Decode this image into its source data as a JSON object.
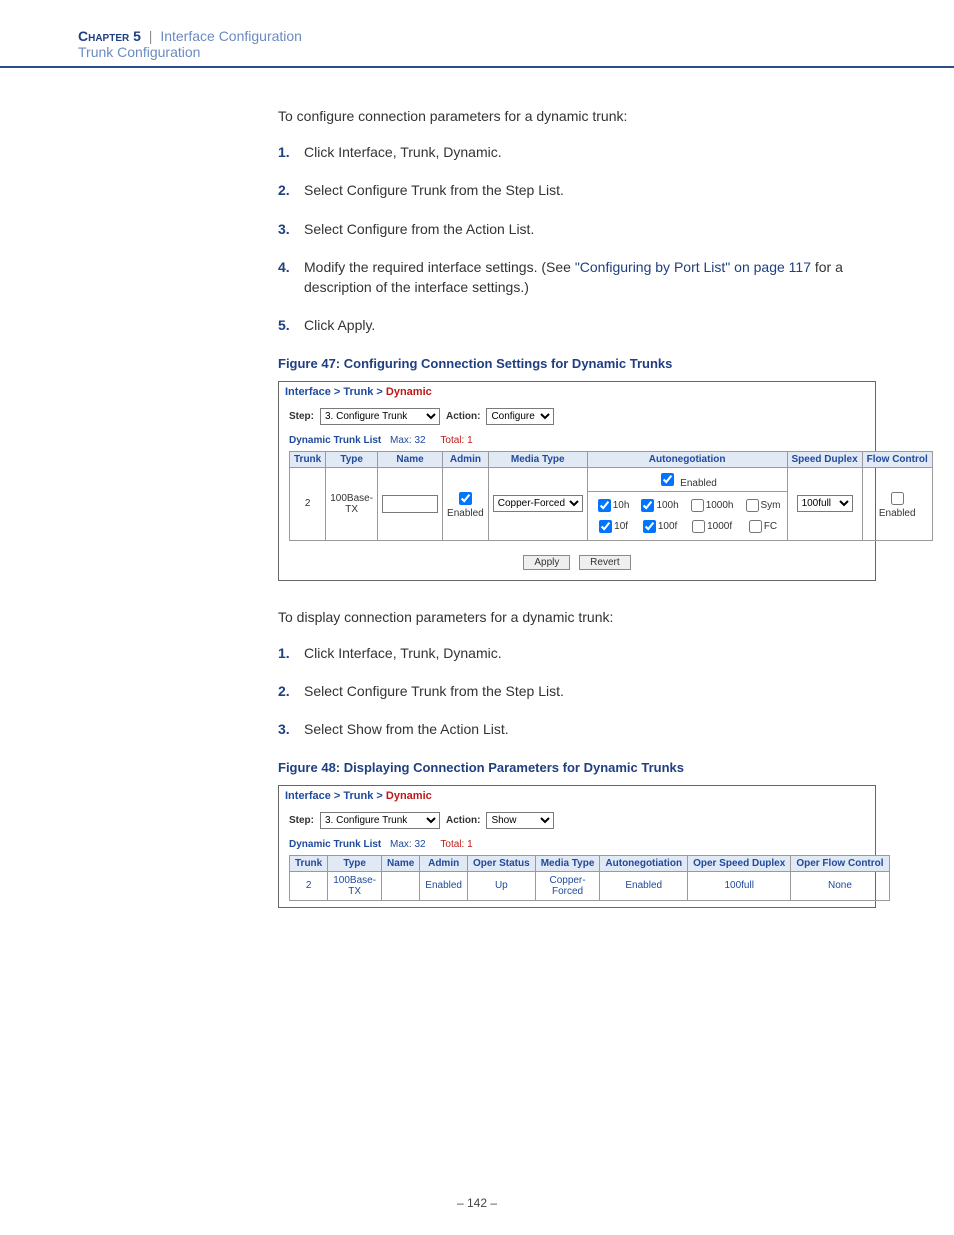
{
  "header": {
    "chapter": "Chapter 5",
    "separator": "|",
    "chapter_title": "Interface Configuration",
    "section": "Trunk Configuration"
  },
  "section1": {
    "intro": "To configure connection parameters for a dynamic trunk:",
    "steps": [
      "Click Interface, Trunk, Dynamic.",
      "Select Configure Trunk from the Step List.",
      "Select Configure from the Action List.",
      "Modify the required interface settings. (See ",
      "Click Apply."
    ],
    "step4_link": "\"Configuring by Port List\" on page 117",
    "step4_tail": " for a description of the interface settings.)",
    "figure_caption": "Figure 47:  Configuring Connection Settings for Dynamic Trunks"
  },
  "shot1": {
    "breadcrumb": {
      "a": "Interface",
      "b": "Trunk",
      "c": "Dynamic"
    },
    "step_label": "Step:",
    "step_value": "3. Configure Trunk",
    "action_label": "Action:",
    "action_value": "Configure",
    "list_title": "Dynamic Trunk List",
    "max_label": "Max: 32",
    "total_label": "Total: 1",
    "headers": [
      "Trunk",
      "Type",
      "Name",
      "Admin",
      "Media Type",
      "Autonegotiation",
      "Speed Duplex",
      "Flow Control"
    ],
    "row": {
      "trunk": "2",
      "type": "100Base-TX",
      "name": "",
      "admin_checked": true,
      "admin_text": "Enabled",
      "media_value": "Copper-Forced",
      "autoneg_enabled_label": "Enabled",
      "autoneg_enabled": true,
      "caps": {
        "h10": {
          "label": "10h",
          "checked": true
        },
        "h100": {
          "label": "100h",
          "checked": true
        },
        "h1000": {
          "label": "1000h",
          "checked": false
        },
        "sym": {
          "label": "Sym",
          "checked": false
        },
        "f10": {
          "label": "10f",
          "checked": true
        },
        "f100": {
          "label": "100f",
          "checked": true
        },
        "f1000": {
          "label": "1000f",
          "checked": false
        },
        "fc": {
          "label": "FC",
          "checked": false
        }
      },
      "speed_duplex": "100full",
      "flow_label": "Enabled",
      "flow_checked": false
    },
    "buttons": {
      "apply": "Apply",
      "revert": "Revert"
    }
  },
  "section2": {
    "intro": "To display connection parameters for a dynamic trunk:",
    "steps": [
      "Click Interface, Trunk, Dynamic.",
      "Select Configure Trunk from the Step List.",
      "Select Show from the Action List."
    ],
    "figure_caption": "Figure 48:  Displaying Connection Parameters for Dynamic Trunks"
  },
  "shot2": {
    "breadcrumb": {
      "a": "Interface",
      "b": "Trunk",
      "c": "Dynamic"
    },
    "step_label": "Step:",
    "step_value": "3. Configure Trunk",
    "action_label": "Action:",
    "action_value": "Show",
    "list_title": "Dynamic Trunk List",
    "max_label": "Max: 32",
    "total_label": "Total: 1",
    "headers": [
      "Trunk",
      "Type",
      "Name",
      "Admin",
      "Oper Status",
      "Media Type",
      "Autonegotiation",
      "Oper Speed Duplex",
      "Oper Flow Control"
    ],
    "row": {
      "trunk": "2",
      "type": "100Base-TX",
      "name": "",
      "admin": "Enabled",
      "oper_status": "Up",
      "media": "Copper-Forced",
      "autoneg": "Enabled",
      "speed": "100full",
      "flow": "None"
    }
  },
  "page_number": "–  142  –"
}
